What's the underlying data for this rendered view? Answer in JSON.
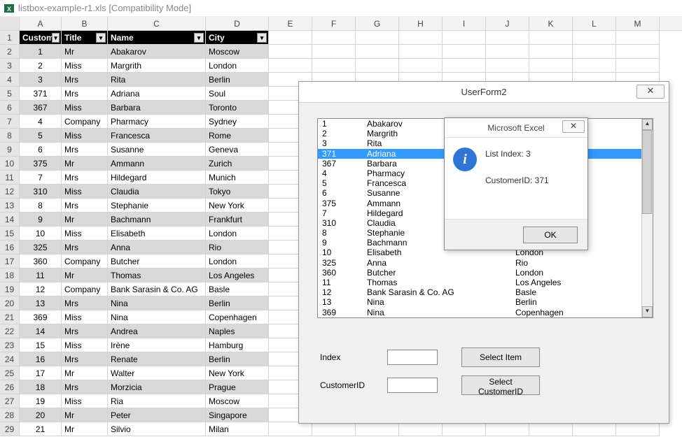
{
  "window": {
    "title": "listbox-example-r1.xls  [Compatibility Mode]"
  },
  "columns": [
    "A",
    "B",
    "C",
    "D",
    "E",
    "F",
    "G",
    "H",
    "I",
    "J",
    "K",
    "L",
    "M"
  ],
  "table_headers": {
    "a": "Customer",
    "b": "Title",
    "c": "Name",
    "d": "City"
  },
  "rows": [
    {
      "n": 2,
      "a": "1",
      "b": "Mr",
      "c": "Abakarov",
      "d": "Moscow",
      "s": true
    },
    {
      "n": 3,
      "a": "2",
      "b": "Miss",
      "c": "Margrith",
      "d": "London",
      "s": false
    },
    {
      "n": 4,
      "a": "3",
      "b": "Mrs",
      "c": " Rita",
      "d": "Berlin",
      "s": true
    },
    {
      "n": 5,
      "a": "371",
      "b": "Mrs",
      "c": "Adriana",
      "d": "Soul",
      "s": false
    },
    {
      "n": 6,
      "a": "367",
      "b": "Miss",
      "c": "Barbara",
      "d": "Toronto",
      "s": true
    },
    {
      "n": 7,
      "a": "4",
      "b": "Company",
      "c": "Pharmacy",
      "d": "Sydney",
      "s": false
    },
    {
      "n": 8,
      "a": "5",
      "b": "Miss",
      "c": "Francesca",
      "d": "Rome",
      "s": true
    },
    {
      "n": 9,
      "a": "6",
      "b": "Mrs",
      "c": "Susanne",
      "d": "Geneva",
      "s": false
    },
    {
      "n": 10,
      "a": "375",
      "b": "Mr",
      "c": "Ammann",
      "d": "Zurich",
      "s": true
    },
    {
      "n": 11,
      "a": "7",
      "b": "Mrs",
      "c": "Hildegard",
      "d": "Munich",
      "s": false
    },
    {
      "n": 12,
      "a": "310",
      "b": "Miss",
      "c": "Claudia",
      "d": "Tokyo",
      "s": true
    },
    {
      "n": 13,
      "a": "8",
      "b": "Mrs",
      "c": " Stephanie",
      "d": "New York",
      "s": false
    },
    {
      "n": 14,
      "a": "9",
      "b": "Mr",
      "c": "Bachmann",
      "d": "Frankfurt",
      "s": true
    },
    {
      "n": 15,
      "a": "10",
      "b": "Miss",
      "c": "Elisabeth",
      "d": "London",
      "s": false
    },
    {
      "n": 16,
      "a": "325",
      "b": "Mrs",
      "c": "Anna",
      "d": "Rio",
      "s": true
    },
    {
      "n": 17,
      "a": "360",
      "b": "Company",
      "c": "Butcher",
      "d": "London",
      "s": false
    },
    {
      "n": 18,
      "a": "11",
      "b": "Mr",
      "c": "Thomas",
      "d": "Los Angeles",
      "s": true
    },
    {
      "n": 19,
      "a": "12",
      "b": "Company",
      "c": "Bank Sarasin & Co. AG",
      "d": "Basle",
      "s": false
    },
    {
      "n": 20,
      "a": "13",
      "b": "Mrs",
      "c": "Nina",
      "d": "Berlin",
      "s": true
    },
    {
      "n": 21,
      "a": "369",
      "b": "Miss",
      "c": "Nina",
      "d": "Copenhagen",
      "s": false
    },
    {
      "n": 22,
      "a": "14",
      "b": "Mrs",
      "c": "Andrea",
      "d": "Naples",
      "s": true
    },
    {
      "n": 23,
      "a": "15",
      "b": "Miss",
      "c": "Irène",
      "d": "Hamburg",
      "s": false
    },
    {
      "n": 24,
      "a": "16",
      "b": "Mrs",
      "c": "Renate",
      "d": "Berlin",
      "s": true
    },
    {
      "n": 25,
      "a": "17",
      "b": "Mr",
      "c": "Walter",
      "d": "New York",
      "s": false
    },
    {
      "n": 26,
      "a": "18",
      "b": "Mrs",
      "c": "Morzicia",
      "d": "Prague",
      "s": true
    },
    {
      "n": 27,
      "a": "19",
      "b": "Miss",
      "c": " Ria",
      "d": "Moscow",
      "s": false
    },
    {
      "n": 28,
      "a": "20",
      "b": "Mr",
      "c": "Peter",
      "d": "Singapore",
      "s": true
    },
    {
      "n": 29,
      "a": "21",
      "b": "Mr",
      "c": "Silvio",
      "d": "Milan",
      "s": false
    }
  ],
  "userform": {
    "title": "UserForm2",
    "index_label": "Index",
    "customerid_label": "CustomerID",
    "select_item_btn": "Select Item",
    "select_customerid_btn": "Select CustomerID",
    "index_value": "",
    "customerid_value": "",
    "selected_index": 3,
    "list": [
      {
        "id": "1",
        "name": "Abakarov",
        "city": ""
      },
      {
        "id": "2",
        "name": "Margrith",
        "city": ""
      },
      {
        "id": "3",
        "name": " Rita",
        "city": ""
      },
      {
        "id": "371",
        "name": "Adriana",
        "city": ""
      },
      {
        "id": "367",
        "name": "Barbara",
        "city": ""
      },
      {
        "id": "4",
        "name": "Pharmacy",
        "city": ""
      },
      {
        "id": "5",
        "name": "Francesca",
        "city": ""
      },
      {
        "id": "6",
        "name": "Susanne",
        "city": ""
      },
      {
        "id": "375",
        "name": "Ammann",
        "city": ""
      },
      {
        "id": "7",
        "name": "Hildegard",
        "city": ""
      },
      {
        "id": "310",
        "name": "Claudia",
        "city": ""
      },
      {
        "id": "8",
        "name": " Stephanie",
        "city": ""
      },
      {
        "id": "9",
        "name": "Bachmann",
        "city": ""
      },
      {
        "id": "10",
        "name": "Elisabeth",
        "city": "London"
      },
      {
        "id": "325",
        "name": "Anna",
        "city": "Rio"
      },
      {
        "id": "360",
        "name": "Butcher",
        "city": "London"
      },
      {
        "id": "11",
        "name": "Thomas",
        "city": "Los Angeles"
      },
      {
        "id": "12",
        "name": "Bank Sarasin & Co. AG",
        "city": "Basle"
      },
      {
        "id": "13",
        "name": "Nina",
        "city": "Berlin"
      },
      {
        "id": "369",
        "name": "Nina",
        "city": "Copenhagen"
      }
    ]
  },
  "msgbox": {
    "title": "Microsoft Excel",
    "line1": "List Index: 3",
    "line2": "CustomerID: 371",
    "ok": "OK"
  }
}
